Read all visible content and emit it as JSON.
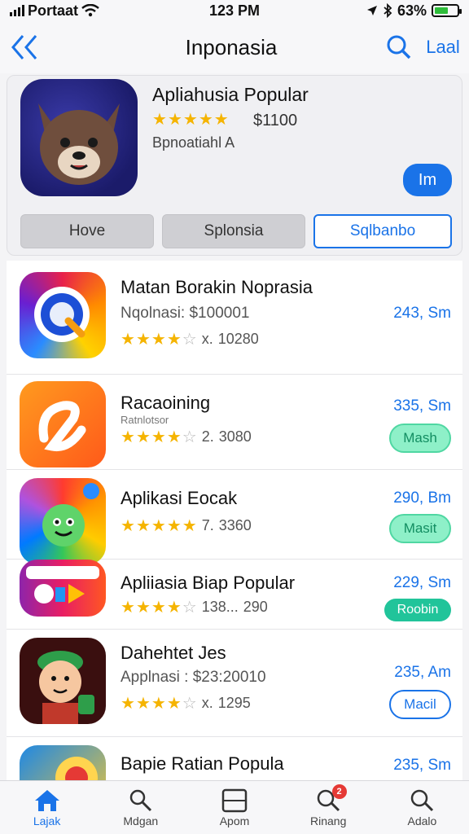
{
  "status_bar": {
    "carrier": "Portaat",
    "time": "123 PM",
    "battery": "63%",
    "battery_level": 0.63
  },
  "nav": {
    "title": "Inponasia",
    "right_label": "Laal",
    "back_icon": "chevron-back-icon",
    "search_icon": "search-icon"
  },
  "featured": {
    "title": "Apliahusia Popular",
    "rating": 4.5,
    "price": "$1100",
    "subtitle": "Bpnoatiahl A",
    "button_label": "Im",
    "tabs": [
      {
        "label": "Hove"
      },
      {
        "label": "Splonsia"
      },
      {
        "label": "Sqlbanbo"
      }
    ]
  },
  "apps": [
    {
      "title": "Matan Borakin Noprasia",
      "subtitle": "Nqolnasi: $100001",
      "rating": 3.5,
      "rating_text": "x.",
      "count": "10280",
      "size": "243, Sm",
      "button": ""
    },
    {
      "title": "Racaoining",
      "subtitle": "Ratnlotsor",
      "rating": 3.5,
      "rating_text": "2.",
      "count": "3080",
      "size": "335, Sm",
      "button": "Mash"
    },
    {
      "title": "Aplikasi Eocak",
      "subtitle": "",
      "rating": 4.5,
      "rating_text": "7.",
      "count": "3360",
      "size": "290, Bm",
      "button": "Masit"
    },
    {
      "title": "Apliiasia Biap Popular",
      "subtitle": "",
      "rating": 4,
      "rating_text": "138...",
      "count": "290",
      "size": "229, Sm",
      "button": "Roobin"
    },
    {
      "title": "Dahehtet Jes",
      "subtitle": "Applnasi : $23:20010",
      "rating": 3.5,
      "rating_text": "x.",
      "count": "1295",
      "size": "235, Am",
      "button": "Macil"
    },
    {
      "title": "Bapie Ratian Popula",
      "subtitle": "",
      "rating": 0,
      "rating_text": "",
      "count": "",
      "size": "235, Sm",
      "button": ""
    }
  ],
  "tab_bar": [
    {
      "label": "Lajak",
      "icon": "home-icon"
    },
    {
      "label": "Mdgan",
      "icon": "search-icon"
    },
    {
      "label": "Apom",
      "icon": "apps-icon"
    },
    {
      "label": "Rinang",
      "icon": "updates-icon",
      "badge": "2"
    },
    {
      "label": "Adalo",
      "icon": "search-icon"
    }
  ],
  "colors": {
    "accent": "#1a73e8",
    "star": "#f5b400",
    "mint": "#8ef0c8",
    "teal": "#21c49a"
  }
}
